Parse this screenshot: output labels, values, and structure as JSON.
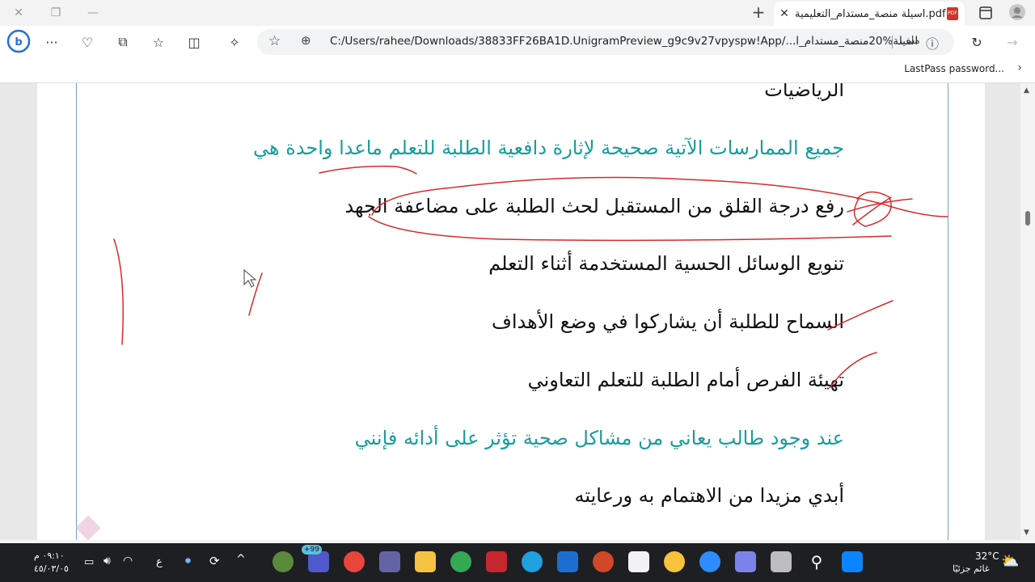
{
  "browser": {
    "tab_title": "اسيلة منصة_مستدام_التعليمية.pdf",
    "pdf_badge": "PDF",
    "url": "C:/Users/rahee/Downloads/38833FF26BA1D.UnigramPreview_g9c9v27vpyspw!App/...اسيلة%20منصة_مستدام_ا",
    "file_label": "ملف",
    "favorite": "LastPass password..."
  },
  "document": {
    "lines": [
      {
        "text": "الرياضيات",
        "kind": "answer"
      },
      {
        "text": "جميع الممارسات الآتية صحيحة لإثارة دافعية الطلبة للتعلم ماعدا واحدة هي",
        "kind": "question"
      },
      {
        "text": "رفع درجة القلق من المستقبل لحث الطلبة على مضاعفة الجهد",
        "kind": "answer"
      },
      {
        "text": "تنويع الوسائل الحسية المستخدمة أثناء التعلم",
        "kind": "answer"
      },
      {
        "text": "السماح للطلبة أن يشاركوا في وضع الأهداف",
        "kind": "answer"
      },
      {
        "text": "تهيئة الفرص أمام الطلبة للتعلم التعاوني",
        "kind": "answer"
      },
      {
        "text": "عند وجود طالب يعاني من مشاكل صحية تؤثر على أدائه فإنني",
        "kind": "question"
      },
      {
        "text": "أبدي مزيدا من الاهتمام به ورعايته",
        "kind": "answer"
      }
    ]
  },
  "taskbar": {
    "time": "٠٩:١٠ م",
    "date": "٤٥/٠٣/٠٥",
    "lang": "ع",
    "temp": "32°C",
    "weather": "غائم جزئيًا",
    "badge": "+99"
  },
  "colors": {
    "question": "#199c9c",
    "answer": "#111111",
    "pen": "#d42b2b"
  }
}
